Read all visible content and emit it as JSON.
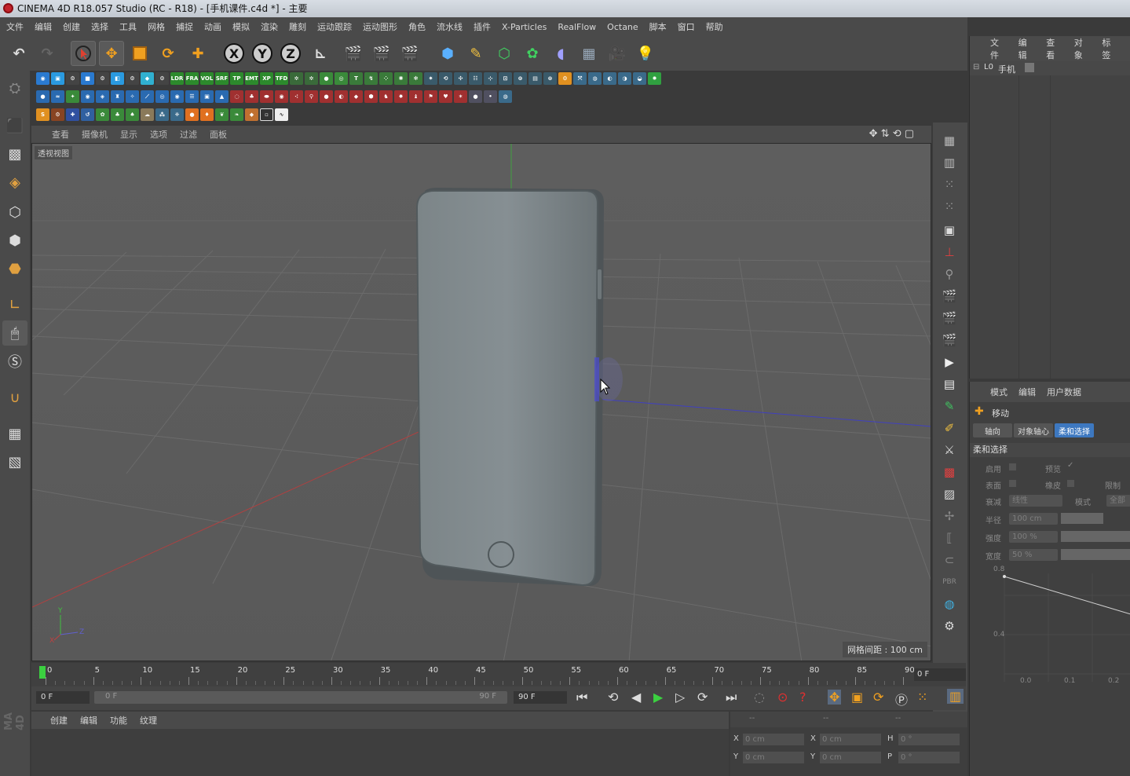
{
  "window": {
    "title": "CINEMA 4D R18.057 Studio (RC - R18) - [手机课件.c4d *] - 主要"
  },
  "menu": [
    "文件",
    "编辑",
    "创建",
    "选择",
    "工具",
    "网格",
    "捕捉",
    "动画",
    "模拟",
    "渲染",
    "雕刻",
    "运动跟踪",
    "运动图形",
    "角色",
    "流水线",
    "插件",
    "X-Particles",
    "RealFlow",
    "Octane",
    "脚本",
    "窗口",
    "帮助"
  ],
  "toolbar": {
    "axis_x": "X",
    "axis_y": "Y",
    "axis_z": "Z",
    "plugin_row1_labels": [
      "LDR",
      "FRA",
      "VOL",
      "SRF",
      "TP",
      "EMT",
      "XP",
      "TFD"
    ]
  },
  "viewport": {
    "menu": [
      "查看",
      "摄像机",
      "显示",
      "选项",
      "过滤",
      "面板"
    ],
    "view_name": "透视视图",
    "grid_spacing": "网格间距 : 100 cm",
    "axis_labels": {
      "y": "Y",
      "z": "Z",
      "x": "X"
    }
  },
  "object_manager": {
    "menu": [
      "文件",
      "编辑",
      "查看",
      "对象",
      "标签"
    ],
    "objects": [
      {
        "label": "手机",
        "layer": "L0"
      }
    ]
  },
  "attribute_manager": {
    "menu": [
      "模式",
      "编辑",
      "用户数据"
    ],
    "tool_name": "移动",
    "tabs": [
      "轴向",
      "对象轴心",
      "柔和选择"
    ],
    "active_tab": "柔和选择",
    "section": "柔和选择",
    "rows": {
      "enable": "启用",
      "preview": "预览",
      "surface": "表面",
      "rubber": "橡皮",
      "limit": "限制",
      "falloff": "衰减",
      "falloff_value": "线性",
      "mode": "模式",
      "mode_value": "全部",
      "radius": "半径",
      "radius_value": "100 cm",
      "strength": "强度",
      "strength_value": "100 %",
      "width": "宽度",
      "width_value": "50 %"
    },
    "graph": {
      "y_ticks": [
        "0.8",
        "0.4"
      ],
      "x_ticks": [
        "0.0",
        "0.1",
        "0.2"
      ]
    }
  },
  "timeline": {
    "ticks": [
      0,
      5,
      10,
      15,
      20,
      25,
      30,
      35,
      40,
      45,
      50,
      55,
      60,
      65,
      70,
      75,
      80,
      85,
      90
    ],
    "current_frame": "0 F",
    "start_field": "0 F",
    "range_start": "0 F",
    "range_end": "90 F",
    "end_field": "90 F"
  },
  "material_manager": {
    "menu": [
      "创建",
      "编辑",
      "功能",
      "纹理"
    ]
  },
  "coordinates": {
    "header": [
      "--",
      "--",
      "--"
    ],
    "rows": [
      {
        "a": "X",
        "av": "0 cm",
        "b": "X",
        "bv": "0 cm",
        "c": "H",
        "cv": "0 °"
      },
      {
        "a": "Y",
        "av": "0 cm",
        "b": "Y",
        "bv": "0 cm",
        "c": "P",
        "cv": "0 °"
      }
    ]
  },
  "side_brand": "MA 4D",
  "colors": {
    "accent_blue": "#4a90d9",
    "x_axis": "#b04040",
    "z_axis": "#4040c0",
    "y_axis": "#40a040"
  }
}
